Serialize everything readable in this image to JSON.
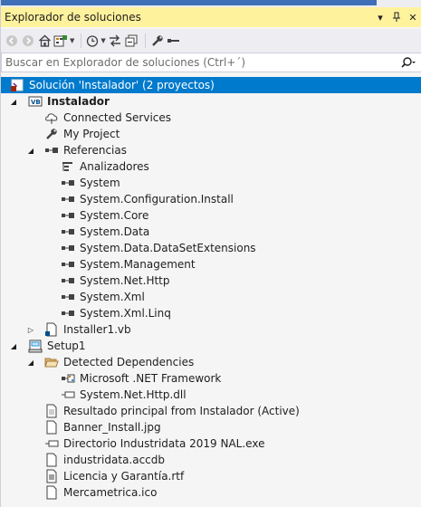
{
  "panel": {
    "title": "Explorador de soluciones",
    "title_buttons": [
      "▾",
      "⫿",
      "✕"
    ]
  },
  "toolbar": {
    "back_icon": "back-arrow-icon",
    "forward_icon": "forward-arrow-icon",
    "home_icon": "home-icon",
    "switch_views_icon": "switch-views-icon",
    "pending_changes_icon": "pending-changes-clock-icon",
    "sync_icon": "sync-with-active-document-icon",
    "collapse_all_icon": "collapse-all-icon",
    "properties_icon": "wrench-properties-icon",
    "preview_icon": "preview-selected-items-icon"
  },
  "search": {
    "placeholder": "Buscar en Explorador de soluciones (Ctrl+´)"
  },
  "tree": {
    "solution": "Solución 'Instalador'  (2 proyectos)",
    "project1": "Instalador",
    "connected_services": "Connected Services",
    "my_project": "My Project",
    "references": "Referencias",
    "analyzers": "Analizadores",
    "refs": [
      "System",
      "System.Configuration.Install",
      "System.Core",
      "System.Data",
      "System.Data.DataSetExtensions",
      "System.Management",
      "System.Net.Http",
      "System.Xml",
      "System.Xml.Linq"
    ],
    "installer_file": "Installer1.vb",
    "project2": "Setup1",
    "detected_deps": "Detected Dependencies",
    "deps": [
      "Microsoft .NET Framework",
      "System.Net.Http.dll"
    ],
    "setup_items": [
      "Resultado principal from Instalador (Active)",
      "Banner_Install.jpg",
      "Directorio Industridata 2019 NAL.exe",
      "industridata.accdb",
      "Licencia y Garantía.rtf",
      "Mercametrica.ico"
    ]
  },
  "colors": {
    "selection": "#007acc",
    "title_active": "#fff29d",
    "background": "#f5f5f5"
  }
}
